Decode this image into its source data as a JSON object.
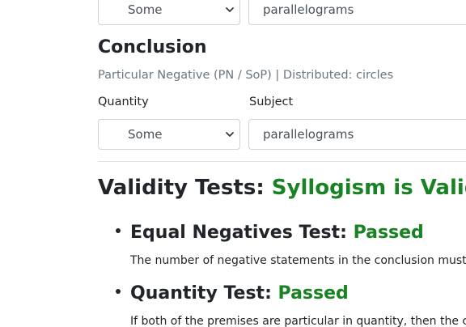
{
  "premise": {
    "quantity_value": "Some",
    "subject_value": "parallelograms"
  },
  "conclusion": {
    "heading": "Conclusion",
    "subtext": "Particular Negative (PN / SoP) | Distributed: circles",
    "quantity_label": "Quantity",
    "subject_label": "Subject",
    "quantity_value": "Some",
    "subject_value": "parallelograms"
  },
  "validity": {
    "heading_prefix": "Validity Tests: ",
    "result": "Syllogism is Valid",
    "tests": [
      {
        "name": "Equal Negatives Test: ",
        "status": "Passed",
        "description": "The number of negative statements in the conclusion must"
      },
      {
        "name": "Quantity Test: ",
        "status": "Passed",
        "description": "If both of the premises are particular in quantity, then the c"
      }
    ]
  },
  "colors": {
    "passed": "#198222",
    "muted": "#6c757d",
    "border": "#ced4da"
  },
  "icons": {
    "select_chevron": "chevron-down-icon"
  }
}
